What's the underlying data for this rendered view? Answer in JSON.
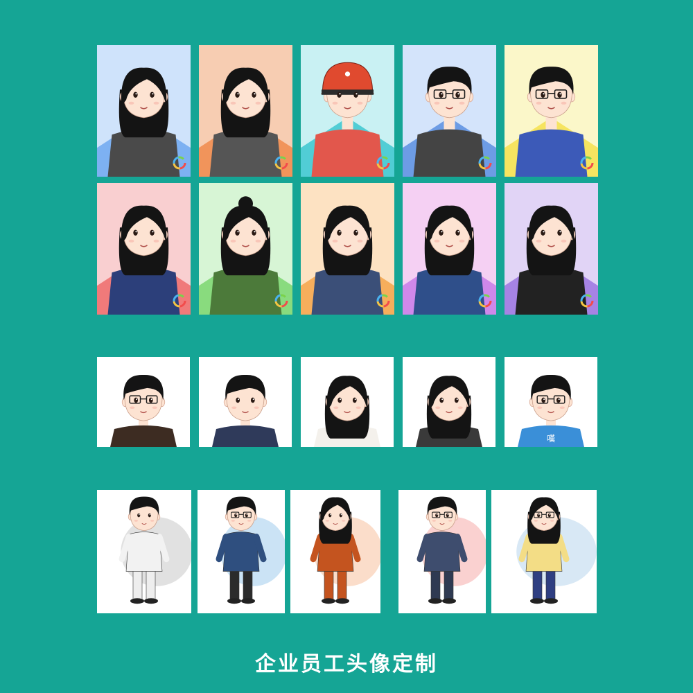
{
  "caption": "企业员工头像定制",
  "style_note": "",
  "groups": [
    {
      "name": "colored-portrait-cards",
      "cards": [
        {
          "bg": "#cfe3fb",
          "accent": "#6fa8f0",
          "hair": "long",
          "glasses": false,
          "shirt": "#4a4a4a",
          "variant": "man"
        },
        {
          "bg": "#f7cdb2",
          "accent": "#f08a4b",
          "hair": "long",
          "glasses": false,
          "shirt": "#555555",
          "variant": "woman"
        },
        {
          "bg": "#c9f1f3",
          "accent": "#3cc7cf",
          "hair": "helmet",
          "glasses": false,
          "shirt": "#e2574c",
          "variant": "woman"
        },
        {
          "bg": "#d4e4fb",
          "accent": "#5b8fe0",
          "hair": "short",
          "glasses": true,
          "shirt": "#444444",
          "variant": "man"
        },
        {
          "bg": "#fbf7c9",
          "accent": "#f4e04e",
          "hair": "short",
          "glasses": true,
          "shirt": "#3c5ab8",
          "variant": "man"
        },
        {
          "bg": "#f9cfd0",
          "accent": "#ef6b6b",
          "hair": "long",
          "glasses": false,
          "shirt": "#2c3f7a",
          "variant": "woman"
        },
        {
          "bg": "#d7f5d5",
          "accent": "#7bd66f",
          "hair": "bun",
          "glasses": false,
          "shirt": "#4c7a3a",
          "variant": "woman"
        },
        {
          "bg": "#fde2c2",
          "accent": "#f5a54a",
          "hair": "long",
          "glasses": false,
          "shirt": "#3b4f78",
          "variant": "woman"
        },
        {
          "bg": "#f5d0f3",
          "accent": "#c87be8",
          "hair": "long",
          "glasses": false,
          "shirt": "#2f4f8a",
          "variant": "woman"
        },
        {
          "bg": "#e1d4f6",
          "accent": "#9b74e0",
          "hair": "long",
          "glasses": false,
          "shirt": "#222222",
          "variant": "woman"
        }
      ]
    },
    {
      "name": "white-bust-cards",
      "cards": [
        {
          "hair": "short",
          "glasses": true,
          "shirt": "#3d2c22",
          "variant": "man"
        },
        {
          "hair": "short",
          "glasses": false,
          "shirt": "#2f3a5a",
          "variant": "man"
        },
        {
          "hair": "long",
          "glasses": false,
          "shirt": "#f4f1ec",
          "variant": "woman"
        },
        {
          "hair": "long",
          "glasses": false,
          "shirt": "#3a3a3a",
          "variant": "woman"
        },
        {
          "hair": "short",
          "glasses": true,
          "shirt": "#3a8fd8",
          "variant": "man",
          "shirt_text": "嘆"
        }
      ]
    },
    {
      "name": "full-body-cards",
      "cards": [
        {
          "hair": "short",
          "glasses": false,
          "outfit": "#f2f2f2",
          "pants": "#eeeeee",
          "splash": "#bdbdbd",
          "variant": "man"
        },
        {
          "hair": "short",
          "glasses": true,
          "outfit": "#2f4f7f",
          "pants": "#2b2b2b",
          "splash": "#8cc0e8",
          "variant": "man"
        },
        {
          "hair": "long",
          "glasses": false,
          "outfit": "#c4541f",
          "pants": "#c4541f",
          "splash": "#f6b38a",
          "variant": "woman"
        },
        {
          "hair": "short",
          "glasses": true,
          "outfit": "#3e4d6e",
          "pants": "#2f3a52",
          "splash": "#f39a96",
          "variant": "man"
        },
        {
          "hair": "long",
          "glasses": true,
          "outfit": "#f3dd86",
          "pants": "#2f3f82",
          "splash": "#a9cbe8",
          "variant": "woman"
        }
      ]
    }
  ]
}
